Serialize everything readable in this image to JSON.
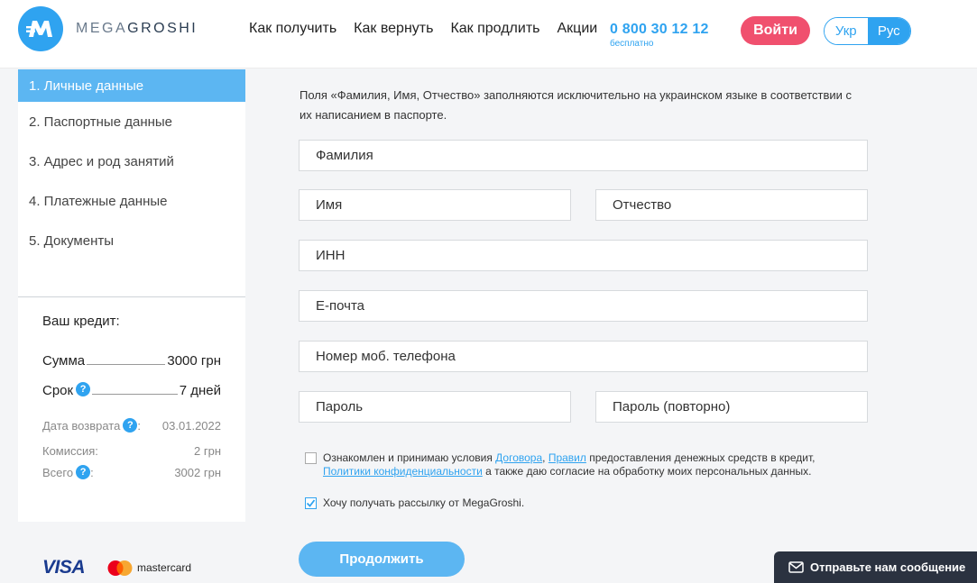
{
  "header": {
    "logo_part1": "MEGA",
    "logo_part2": "GROSHI",
    "nav": [
      "Как получить",
      "Как вернуть",
      "Как продлить",
      "Акции"
    ],
    "phone": "0 800 30 12 12",
    "phone_note": "бесплатно",
    "login_label": "Войти",
    "lang_ukr": "Укр",
    "lang_rus": "Рус"
  },
  "sidebar": {
    "steps": [
      "1. Личные данные",
      "2. Паспортные данные",
      "3. Адрес и род занятий",
      "4. Платежные данные",
      "5. Документы"
    ],
    "credit_title": "Ваш кредит:",
    "sum_label": "Сумма",
    "sum_value": "3000 грн",
    "term_label": "Срок",
    "term_value": "7 дней",
    "return_label": "Дата возврата",
    "return_value": "03.01.2022",
    "commission_label": "Комиссия:",
    "commission_value": "2 грн",
    "total_label": "Всего",
    "total_colon": ":",
    "total_value": "3002 грн"
  },
  "payments": {
    "visa": "VISA",
    "mastercard": "mastercard"
  },
  "form": {
    "intro": "Поля «Фамилия, Имя, Отчество» заполняются исключительно на украинском языке в соответствии с их написанием в паспорте.",
    "surname": "Фамилия",
    "name": "Имя",
    "patronymic": "Отчество",
    "inn": "ИНН",
    "email": "Е-почта",
    "phone": "Номер моб. телефона",
    "password": "Пароль",
    "password_repeat": "Пароль (повторно)",
    "agree_t1": "Ознакомлен и принимаю условия ",
    "agree_link1": "Договора",
    "agree_t2": ", ",
    "agree_link2": "Правил",
    "agree_t3": " предоставления денежных средств в кредит,",
    "agree_link3": "Политики конфиденциальности",
    "agree_t4": " а также даю согласие на обработку моих персональных данных.",
    "newsletter": "Хочу получать рассылку от MegaGroshi.",
    "agree_checked": false,
    "newsletter_checked": true,
    "continue_label": "Продолжить"
  },
  "chat": {
    "label": "Отправьте нам сообщение"
  },
  "colors": {
    "accent": "#2fa3f0",
    "login": "#f0506e",
    "active_step": "#5cb6f2"
  }
}
